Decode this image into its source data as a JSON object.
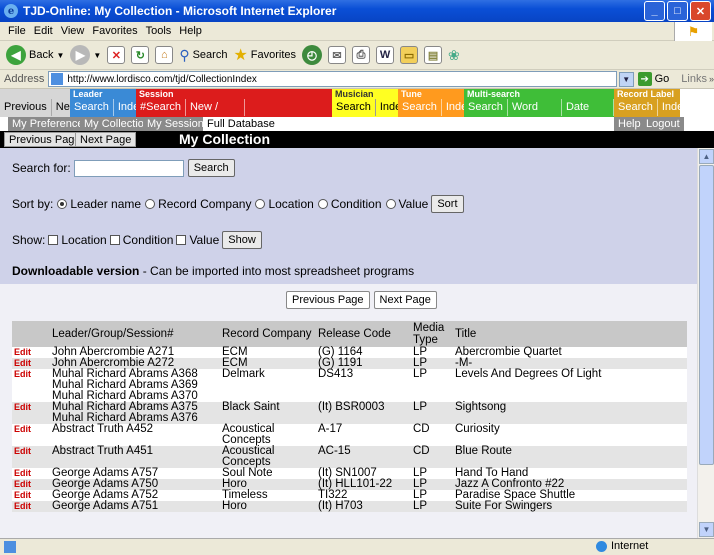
{
  "window": {
    "title": "TJD-Online: My Collection - Microsoft Internet Explorer"
  },
  "menu": [
    "File",
    "Edit",
    "View",
    "Favorites",
    "Tools",
    "Help"
  ],
  "toolbar": {
    "back": "Back",
    "search": "Search",
    "favorites": "Favorites"
  },
  "address": {
    "label": "Address",
    "url": "http://www.lordisco.com/tjd/CollectionIndex",
    "go": "Go",
    "links": "Links"
  },
  "nav": {
    "prev": "Previous",
    "next": "Next",
    "groups": [
      {
        "label": "Leader",
        "color": "#3a8ad6",
        "items": [
          "Search",
          "Index"
        ]
      },
      {
        "label": "Session",
        "color": "#dc1c1c",
        "items": [
          "#Search",
          "New / Reissues"
        ]
      },
      {
        "label": "Musician",
        "color": "#ffff22",
        "items": [
          "Search",
          "Index"
        ]
      },
      {
        "label": "Tune",
        "color": "#ff9a1e",
        "items": [
          "Search",
          "Index"
        ]
      },
      {
        "label": "Multi-search",
        "color": "#3fbe38",
        "items": [
          "Search",
          "Word Search",
          "Date Search"
        ]
      },
      {
        "label": "Record Label",
        "color": "#d8a020",
        "items": [
          "Search",
          "Index"
        ]
      }
    ]
  },
  "subnav": {
    "my_preferences": "My Preferences",
    "my_collection": "My Collection",
    "my_sessions": "My Sessions",
    "full_database": "Full Database",
    "help": "Help",
    "logout": "Logout"
  },
  "page": {
    "prev_page": "Previous Page",
    "next_page": "Next Page",
    "title": "My Collection"
  },
  "search": {
    "label": "Search for:",
    "value": "",
    "button": "Search"
  },
  "sort": {
    "label": "Sort by:",
    "options": [
      "Leader name",
      "Record Company",
      "Location",
      "Condition",
      "Value"
    ],
    "selected": "Leader name",
    "button": "Sort"
  },
  "show": {
    "label": "Show:",
    "options": [
      "Location",
      "Condition",
      "Value"
    ],
    "button": "Show"
  },
  "downloadable": {
    "bold": "Downloadable version",
    "rest": " - Can be imported into most spreadsheet programs"
  },
  "pager": {
    "prev": "Previous Page",
    "next": "Next Page"
  },
  "table": {
    "headers": [
      "Leader/Group/Session#",
      "Record Company",
      "Release Code",
      "Media Type",
      "Title"
    ],
    "edit_label": "Edit",
    "rows": [
      {
        "edit": true,
        "leader": [
          "John Abercrombie A271"
        ],
        "company": "ECM",
        "code": "(G) 1164",
        "media": "LP",
        "title": "Abercrombie Quartet"
      },
      {
        "edit": true,
        "leader": [
          "John Abercrombie A272"
        ],
        "company": "ECM",
        "code": "(G) 1191",
        "media": "LP",
        "title": "-M-"
      },
      {
        "edit": true,
        "leader": [
          "Muhal Richard Abrams A368",
          "Muhal Richard Abrams A369",
          "Muhal Richard Abrams A370"
        ],
        "company": "Delmark",
        "code": "DS413",
        "media": "LP",
        "title": "Levels And Degrees Of Light"
      },
      {
        "edit": true,
        "leader": [
          "Muhal Richard Abrams A375",
          "Muhal Richard Abrams A376"
        ],
        "company": "Black Saint",
        "code": "(It) BSR0003",
        "media": "LP",
        "title": "Sightsong"
      },
      {
        "edit": true,
        "leader": [
          "Abstract Truth A452"
        ],
        "company": "Acoustical Concepts",
        "code": "A-17",
        "media": "CD",
        "title": "Curiosity"
      },
      {
        "edit": true,
        "leader": [
          "Abstract Truth A451"
        ],
        "company": "Acoustical Concepts",
        "code": "AC-15",
        "media": "CD",
        "title": "Blue Route"
      },
      {
        "edit": true,
        "leader": [
          "George Adams A757"
        ],
        "company": "Soul Note",
        "code": "(It) SN1007",
        "media": "LP",
        "title": "Hand To Hand"
      },
      {
        "edit": true,
        "leader": [
          "George Adams A750"
        ],
        "company": "Horo",
        "code": "(It) HLL101-22",
        "media": "LP",
        "title": "Jazz A Confronto #22"
      },
      {
        "edit": true,
        "leader": [
          "George Adams A752"
        ],
        "company": "Timeless",
        "code": "TI322",
        "media": "LP",
        "title": "Paradise Space Shuttle"
      },
      {
        "edit": true,
        "leader": [
          "George Adams A751"
        ],
        "company": "Horo",
        "code": "(It) H703",
        "media": "LP",
        "title": "Suite For Swingers"
      }
    ]
  },
  "status": {
    "zone": "Internet"
  }
}
